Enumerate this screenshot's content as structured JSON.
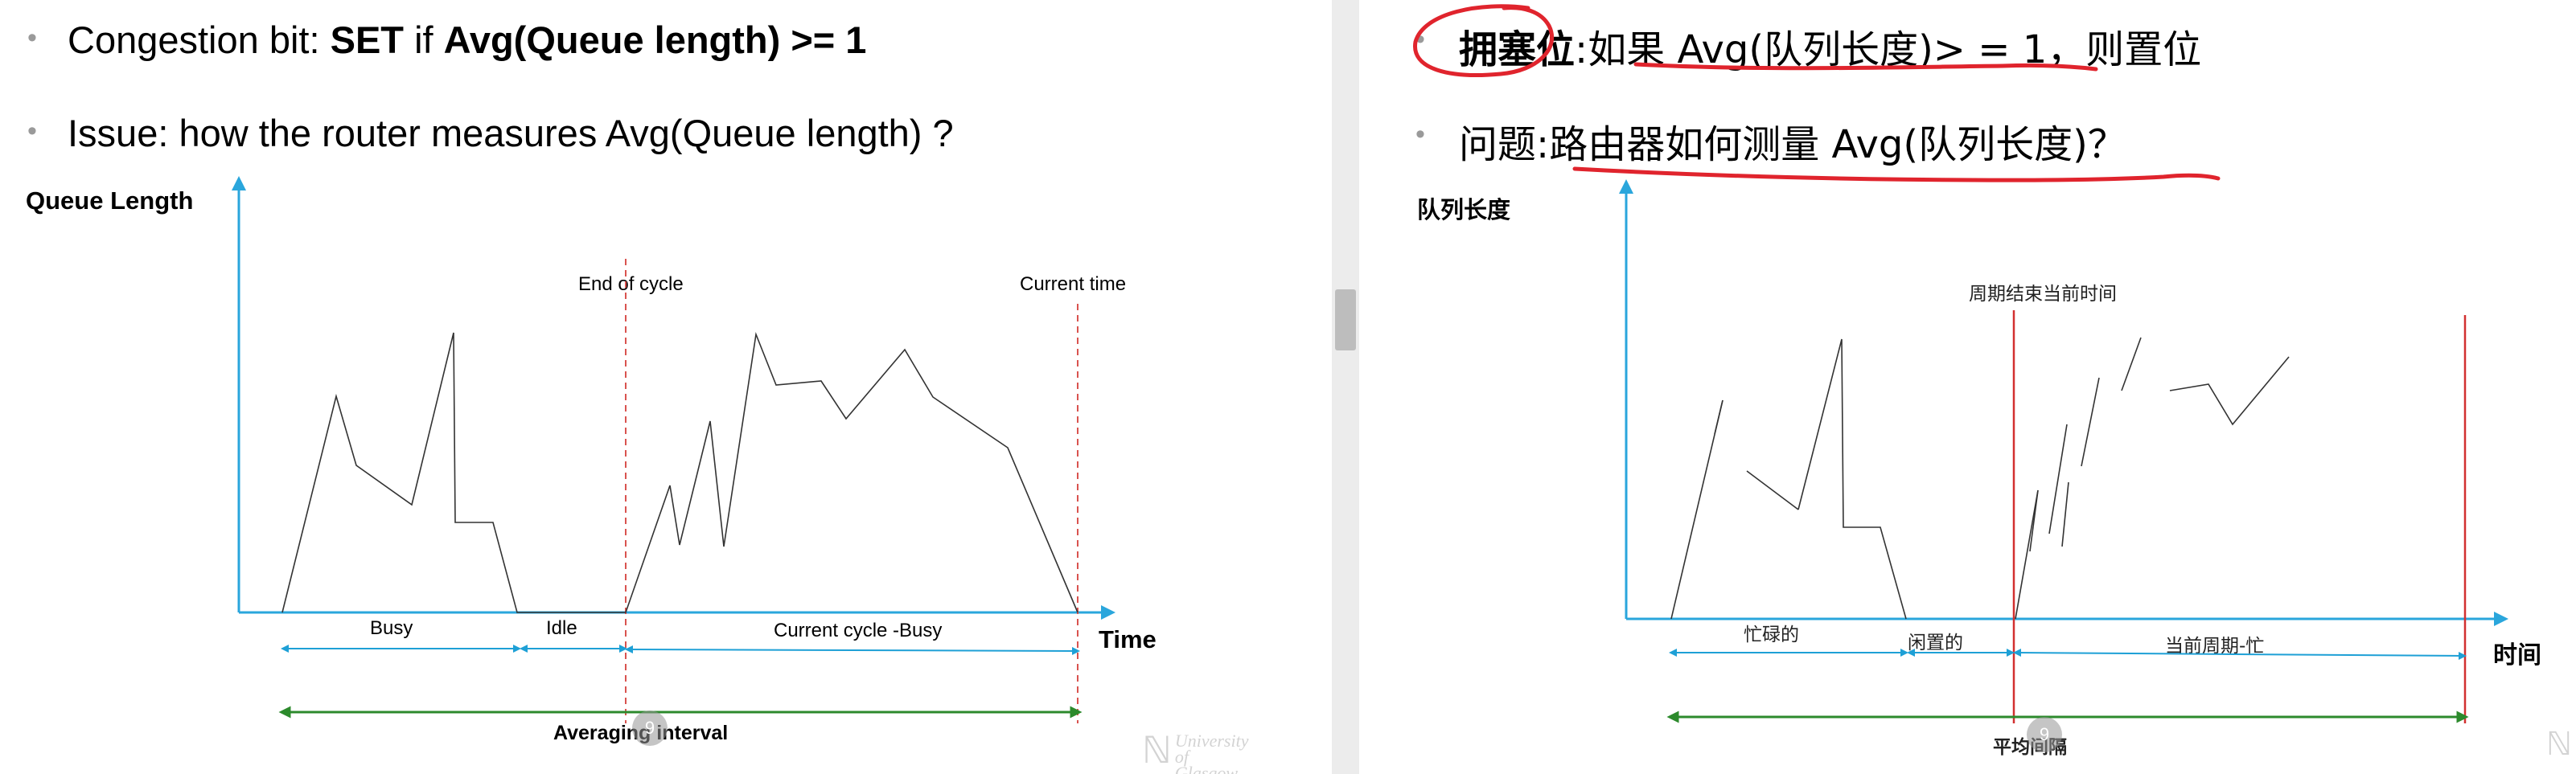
{
  "left": {
    "bullet1": {
      "prefix": "Congestion bit: ",
      "set": "SET",
      "mid": " if ",
      "cond": "Avg(Queue length) >= 1"
    },
    "bullet2": "Issue: how the router measures Avg(Queue length) ?",
    "y_axis_title": "Queue Length",
    "x_axis_title": "Time",
    "end_of_cycle": "End of cycle",
    "current_time": "Current time",
    "busy": "Busy",
    "idle": "Idle",
    "current_cycle_busy": "Current cycle -Busy",
    "averaging_interval": "Averaging interval",
    "logo_line1": "University",
    "logo_line2": "of Glasgow"
  },
  "right": {
    "bullet1": {
      "prefix": "拥塞位",
      "rest": ":如果 Avg(队列长度)> = 1，则置位"
    },
    "bullet2": {
      "prefix": "问题:",
      "rest": "路由器如何测量 Avg(队列长度)？"
    },
    "y_axis_title": "队列长度",
    "x_axis_title": "时间",
    "cycle_label": "周期结束当前时间",
    "busy": "忙碌的",
    "idle": "闲置的",
    "current_cycle_busy": "当前周期-忙",
    "averaging_interval": "平均间隔"
  },
  "cursor_number": "9",
  "colors": {
    "axis": "#2aa6dc",
    "interval_arrow": "#1ea0d6",
    "averaging_arrow": "#2c8a2c",
    "dashed_marker": "#d9534f",
    "annotation": "#e0242d",
    "bullet_dot": "#9a9a9a"
  }
}
